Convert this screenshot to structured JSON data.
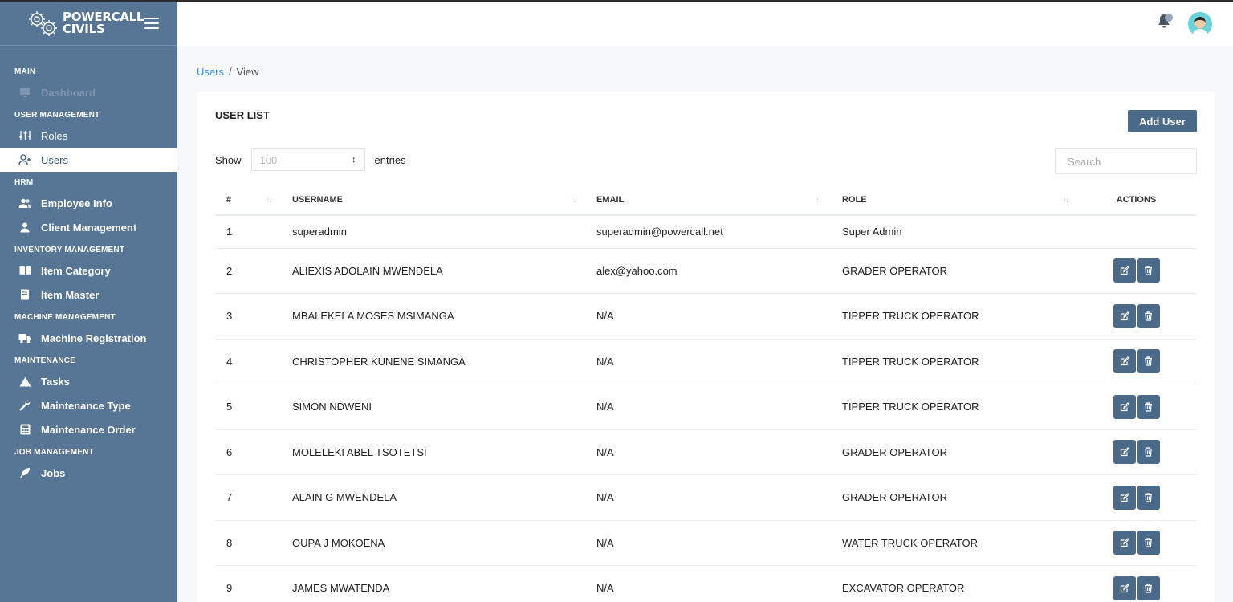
{
  "brand": {
    "line1": "POWERCALL",
    "line2": "CIVILS"
  },
  "sidebar": {
    "sections": [
      {
        "title": "MAIN",
        "items": [
          {
            "label": "Dashboard",
            "icon": "monitor-icon",
            "state": "disabled"
          }
        ]
      },
      {
        "title": "USER MANAGEMENT",
        "items": [
          {
            "label": "Roles",
            "icon": "sliders-icon",
            "state": "normal"
          },
          {
            "label": "Users",
            "icon": "user-plus-icon",
            "state": "active"
          }
        ]
      },
      {
        "title": "HRM",
        "items": [
          {
            "label": "Employee Info",
            "icon": "users-icon",
            "state": "normal"
          },
          {
            "label": "Client Management",
            "icon": "user-icon",
            "state": "normal"
          }
        ]
      },
      {
        "title": "INVENTORY MANAGEMENT",
        "items": [
          {
            "label": "Item Category",
            "icon": "book-open-icon",
            "state": "normal"
          },
          {
            "label": "Item Master",
            "icon": "book-icon",
            "state": "normal"
          }
        ]
      },
      {
        "title": "MACHINE MANAGEMENT",
        "items": [
          {
            "label": "Machine Registration",
            "icon": "truck-icon",
            "state": "normal"
          }
        ]
      },
      {
        "title": "MAINTENANCE",
        "items": [
          {
            "label": "Tasks",
            "icon": "warning-triangle-icon",
            "state": "normal"
          },
          {
            "label": "Maintenance Type",
            "icon": "wrench-icon",
            "state": "normal"
          },
          {
            "label": "Maintenance Order",
            "icon": "calculator-icon",
            "state": "normal"
          }
        ]
      },
      {
        "title": "JOB MANAGEMENT",
        "items": [
          {
            "label": "Jobs",
            "icon": "feather-icon",
            "state": "normal"
          }
        ]
      }
    ]
  },
  "breadcrumb": {
    "parent": "Users",
    "separator": "/",
    "current": "View"
  },
  "card": {
    "title": "USER LIST",
    "add_button": "Add User",
    "show_label": "Show",
    "entries_value": "100",
    "entries_label": "entries",
    "search_placeholder": "Search"
  },
  "table": {
    "columns": [
      "#",
      "USERNAME",
      "EMAIL",
      "ROLE",
      "ACTIONS"
    ],
    "rows": [
      {
        "num": "1",
        "username": "superadmin",
        "email": "superadmin@powercall.net",
        "role": "Super Admin",
        "actions": false
      },
      {
        "num": "2",
        "username": "ALIEXIS ADOLAIN MWENDELA",
        "email": "alex@yahoo.com",
        "role": "GRADER OPERATOR",
        "actions": true
      },
      {
        "num": "3",
        "username": "MBALEKELA MOSES MSIMANGA",
        "email": "N/A",
        "role": "TIPPER TRUCK OPERATOR",
        "actions": true
      },
      {
        "num": "4",
        "username": "CHRISTOPHER KUNENE SIMANGA",
        "email": "N/A",
        "role": "TIPPER TRUCK OPERATOR",
        "actions": true
      },
      {
        "num": "5",
        "username": "SIMON NDWENI",
        "email": "N/A",
        "role": "TIPPER TRUCK OPERATOR",
        "actions": true
      },
      {
        "num": "6",
        "username": "MOLELEKI ABEL TSOTETSI",
        "email": "N/A",
        "role": "GRADER OPERATOR",
        "actions": true
      },
      {
        "num": "7",
        "username": "ALAIN G MWENDELA",
        "email": "N/A",
        "role": "GRADER OPERATOR",
        "actions": true
      },
      {
        "num": "8",
        "username": "OUPA J MOKOENA",
        "email": "N/A",
        "role": "WATER TRUCK OPERATOR",
        "actions": true
      },
      {
        "num": "9",
        "username": "JAMES MWATENDA",
        "email": "N/A",
        "role": "EXCAVATOR OPERATOR",
        "actions": true
      }
    ]
  },
  "colors": {
    "sidebar": "#577594",
    "accent": "#4b6a8a",
    "link": "#3d8fd8",
    "avatar_bg": "#6bd3d9"
  }
}
